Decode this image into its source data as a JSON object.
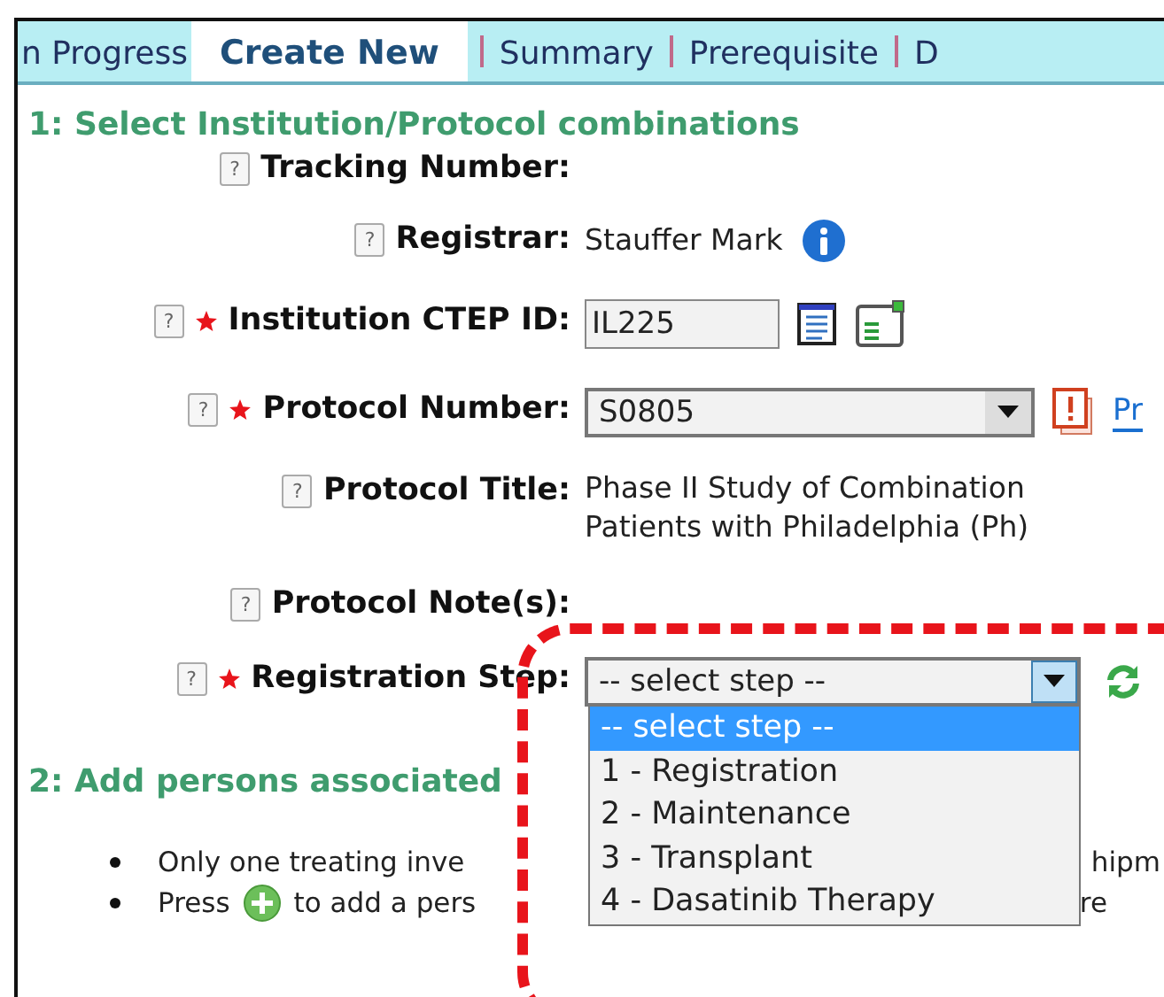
{
  "tabs": [
    {
      "label": "n Progress",
      "selected": false
    },
    {
      "label": "Create New",
      "selected": true
    },
    {
      "label": "Summary",
      "selected": false
    },
    {
      "label": "Prerequisite",
      "selected": false
    },
    {
      "label": "D",
      "selected": false
    }
  ],
  "section_1": {
    "title": "1: Select Institution/Protocol combinations"
  },
  "fields": [
    {
      "kind": "empty",
      "help": "?",
      "required": false,
      "label": "Tracking Number:"
    },
    {
      "kind": "text",
      "help": "?",
      "required": false,
      "label": "Registrar:",
      "lines": [
        "Stauffer Mark"
      ],
      "info": true
    },
    {
      "kind": "input",
      "help": "?",
      "required": true,
      "label": "Institution CTEP ID:",
      "value": "IL225"
    },
    {
      "kind": "select",
      "help": "?",
      "required": true,
      "label": "Protocol Number:",
      "value": "S0805",
      "link": "Pr"
    },
    {
      "kind": "text",
      "help": "?",
      "required": false,
      "label": "Protocol Title:",
      "lines": [
        "Phase II Study of Combination",
        "Patients with Philadelphia (Ph)"
      ]
    },
    {
      "kind": "empty",
      "help": "?",
      "required": false,
      "label": "Protocol Note(s):"
    },
    {
      "kind": "dropdown",
      "help": "?",
      "required": true,
      "label": "Registration Step:",
      "value": "-- select step --",
      "expanded": true,
      "options": [
        {
          "label": "-- select step --",
          "selected": true
        },
        {
          "label": "1 - Registration",
          "selected": false
        },
        {
          "label": "2 - Maintenance",
          "selected": false
        },
        {
          "label": "3 - Transplant",
          "selected": false
        },
        {
          "label": "4 - Dasatinib Therapy",
          "selected": false
        }
      ]
    }
  ],
  "section_2": {
    "title": "2: Add persons associated"
  },
  "bullets": [
    {
      "kind": "plain",
      "left": "Only one treating inve",
      "right": "hipm"
    },
    {
      "kind": "add",
      "before": "Press",
      "left": "to add a pers",
      "right": "re"
    }
  ]
}
